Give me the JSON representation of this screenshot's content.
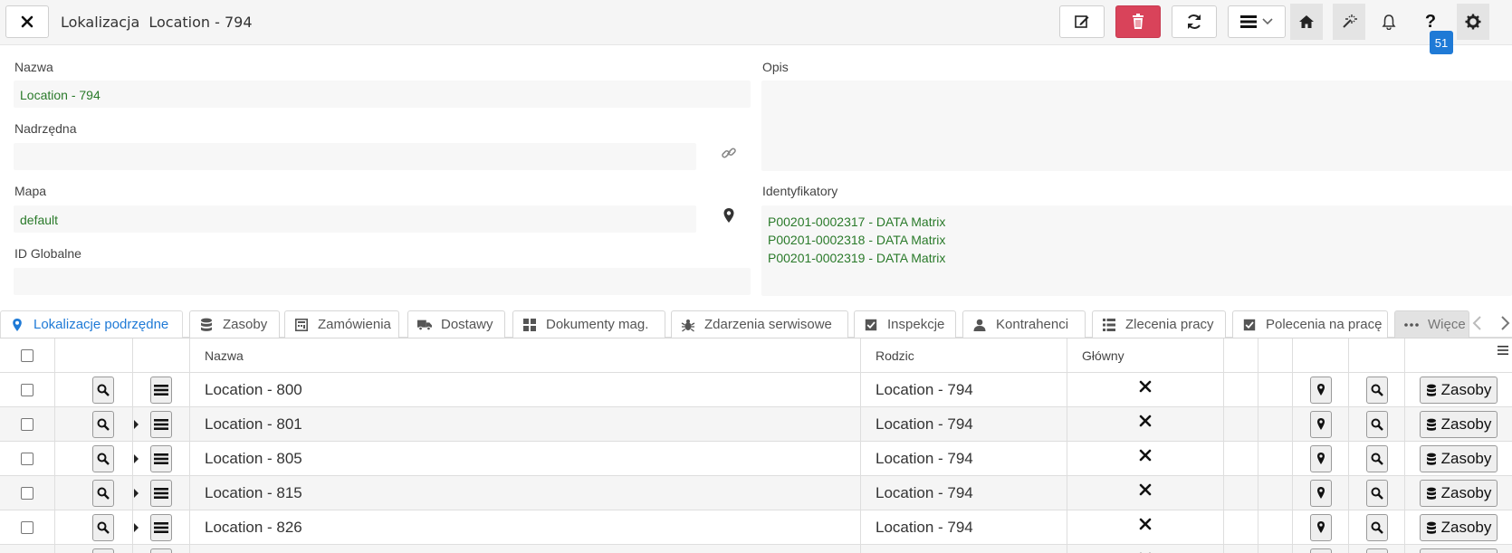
{
  "header": {
    "module": "Lokalizacja",
    "record": "Location - 794",
    "notifications_count": "51"
  },
  "form": {
    "nazwa_label": "Nazwa",
    "nazwa_value": "Location - 794",
    "nadrzedna_label": "Nadrzędna",
    "nadrzedna_value": "",
    "mapa_label": "Mapa",
    "mapa_value": "default",
    "id_globalne_label": "ID Globalne",
    "id_globalne_value": "",
    "opis_label": "Opis",
    "opis_value": "",
    "identyfikatory_label": "Identyfikatory",
    "identyfikatory": [
      "P00201-0002317 - DATA Matrix",
      "P00201-0002318 - DATA Matrix",
      "P00201-0002319 - DATA Matrix"
    ]
  },
  "tabs": [
    {
      "label": "Lokalizacje podrzędne",
      "icon": "map-pin-icon"
    },
    {
      "label": "Zasoby",
      "icon": "database-icon"
    },
    {
      "label": "Zamówienia",
      "icon": "calculator-icon"
    },
    {
      "label": "Dostawy",
      "icon": "truck-icon"
    },
    {
      "label": "Dokumenty mag.",
      "icon": "grid-icon"
    },
    {
      "label": "Zdarzenia serwisowe",
      "icon": "bug-icon"
    },
    {
      "label": "Inspekcje",
      "icon": "checkbox-icon"
    },
    {
      "label": "Kontrahenci",
      "icon": "user-icon"
    },
    {
      "label": "Zlecenia pracy",
      "icon": "list-icon"
    },
    {
      "label": "Polecenia na pracę",
      "icon": "checkbox-icon"
    },
    {
      "label": "Więce",
      "icon": "more-icon"
    }
  ],
  "table": {
    "headers": {
      "nazwa": "Nazwa",
      "rodzic": "Rodzic",
      "glowny": "Główny"
    },
    "zasoby_button": "Zasoby",
    "rows": [
      {
        "nazwa": "Location - 800",
        "rodzic": "Location - 794",
        "expandable": false
      },
      {
        "nazwa": "Location - 801",
        "rodzic": "Location - 794",
        "expandable": true
      },
      {
        "nazwa": "Location - 805",
        "rodzic": "Location - 794",
        "expandable": true
      },
      {
        "nazwa": "Location - 815",
        "rodzic": "Location - 794",
        "expandable": true
      },
      {
        "nazwa": "Location - 826",
        "rodzic": "Location - 794",
        "expandable": true
      }
    ]
  },
  "colors": {
    "accent": "#1f7ad6",
    "danger": "#d9435a",
    "value_text": "#2a7a2a"
  }
}
